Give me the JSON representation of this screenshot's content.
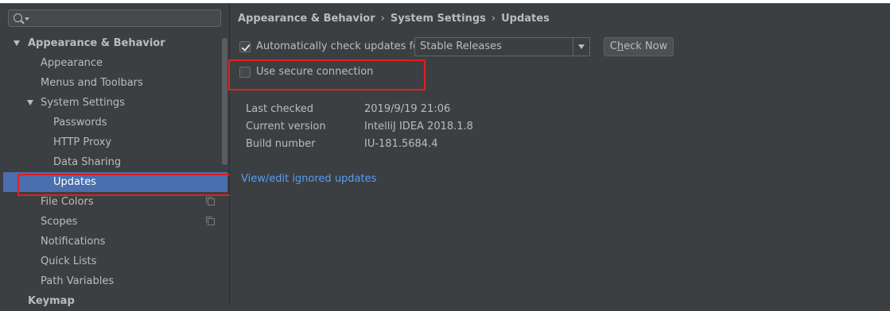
{
  "search": {
    "value": "",
    "placeholder": ""
  },
  "sidebar": {
    "items": [
      {
        "label": "Appearance & Behavior"
      },
      {
        "label": "Appearance"
      },
      {
        "label": "Menus and Toolbars"
      },
      {
        "label": "System Settings"
      },
      {
        "label": "Passwords"
      },
      {
        "label": "HTTP Proxy"
      },
      {
        "label": "Data Sharing"
      },
      {
        "label": "Updates"
      },
      {
        "label": "File Colors"
      },
      {
        "label": "Scopes"
      },
      {
        "label": "Notifications"
      },
      {
        "label": "Quick Lists"
      },
      {
        "label": "Path Variables"
      },
      {
        "label": "Keymap"
      }
    ]
  },
  "breadcrumb": [
    "Appearance & Behavior",
    "System Settings",
    "Updates"
  ],
  "auto_check": {
    "label": "Automatically check updates for",
    "checked": true
  },
  "channel_select": {
    "value": "Stable Releases"
  },
  "check_now_button": {
    "label_prefix": "C",
    "label_underlined": "h",
    "label_rest": "eck Now"
  },
  "secure_connection": {
    "label": "Use secure connection",
    "checked": false
  },
  "info": {
    "last_checked_label": "Last checked",
    "last_checked_value": "2019/9/19 21:06",
    "current_version_label": "Current version",
    "current_version_value": "IntelliJ IDEA 2018.1.8",
    "build_number_label": "Build number",
    "build_number_value": "IU-181.5684.4"
  },
  "ignored_updates_link": "View/edit ignored updates",
  "colors": {
    "accent": "#4b6eaf",
    "highlight": "#e02020",
    "link": "#589df6",
    "background": "#3c3f41"
  }
}
